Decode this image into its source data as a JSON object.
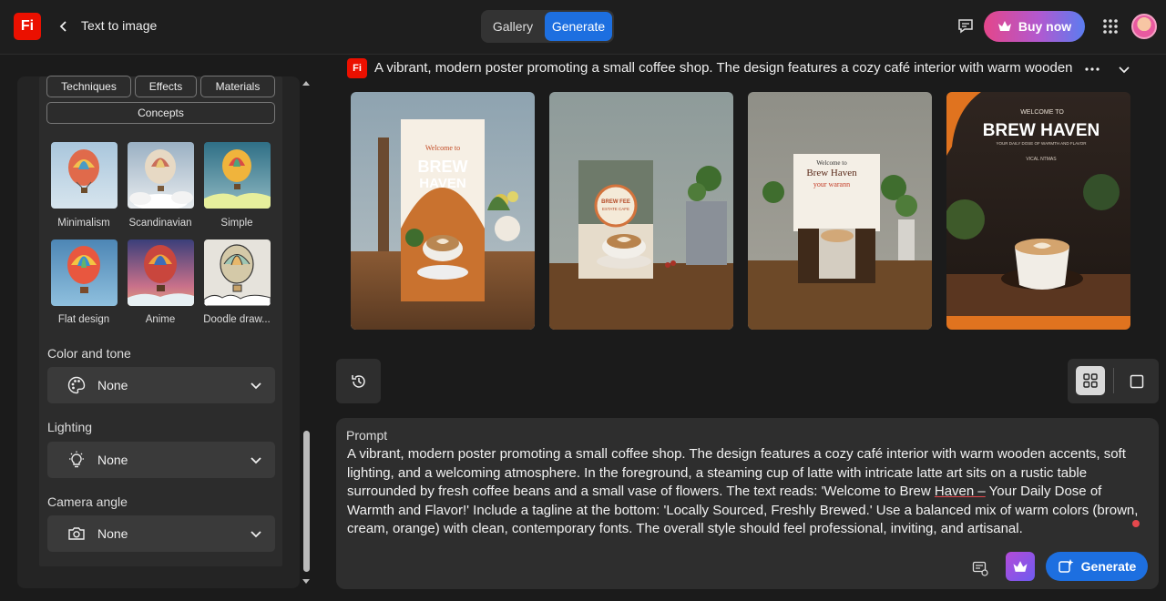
{
  "header": {
    "logo_text": "Fi",
    "title": "Text to image",
    "tabs": [
      {
        "label": "Gallery",
        "active": false
      },
      {
        "label": "Generate",
        "active": true
      }
    ],
    "buy_label": "Buy now",
    "icons": [
      "feedback-icon",
      "crown-icon",
      "apps-grid-icon",
      "avatar"
    ]
  },
  "sidebar": {
    "style_tabs": [
      "Techniques",
      "Effects",
      "Materials",
      "Concepts"
    ],
    "styles": [
      {
        "label": "Minimalism"
      },
      {
        "label": "Scandinavian"
      },
      {
        "label": "Simple"
      },
      {
        "label": "Flat design"
      },
      {
        "label": "Anime"
      },
      {
        "label": "Doodle draw..."
      }
    ],
    "color_tone": {
      "label": "Color and tone",
      "value": "None",
      "icon": "palette-icon"
    },
    "lighting": {
      "label": "Lighting",
      "value": "None",
      "icon": "lightbulb-icon"
    },
    "camera_angle": {
      "label": "Camera angle",
      "value": "None",
      "icon": "camera-icon"
    }
  },
  "prompt_header": {
    "badge": "Fi",
    "text": "A vibrant, modern poster promoting a small coffee shop. The design features a cozy café interior with warm wooden accents, soft"
  },
  "results": [
    {
      "title_lines": [
        "Welcome to",
        "BREW",
        "HAVEN"
      ]
    },
    {
      "title_lines": [
        "BREW FEE",
        "ESTATE CAFE"
      ]
    },
    {
      "title_lines": [
        "Welcome to",
        "Brew Haven",
        "your warann"
      ]
    },
    {
      "title_lines": [
        "WELCOME TO",
        "BREW HAVEN",
        "YOUR DAILY DOSE OF WARMTH AND FLAVOR",
        "VICAL NTMAS"
      ]
    }
  ],
  "prompt": {
    "label": "Prompt",
    "text_before": " A vibrant, modern poster promoting a small coffee shop. The design features a cozy café interior with warm wooden accents, soft lighting, and a welcoming atmosphere. In the foreground, a steaming cup of latte with intricate latte art sits on a rustic table surrounded by fresh coffee beans and a small vase of flowers. The text reads: 'Welcome to Brew ",
    "underlined": "Haven –",
    "text_after": " Your Daily Dose of Warmth and Flavor!' Include a tagline at the bottom: 'Locally Sourced, Freshly Brewed.' Use a balanced mix of warm colors (brown, cream, orange) with clean, contemporary fonts. The overall style should feel professional, inviting, and artisanal."
  },
  "generate_label": "Generate",
  "colors": {
    "accent": "#1d6fe0",
    "brand": "#eb1000",
    "background": "#1b1b1b",
    "panel": "#2c2c2c"
  }
}
